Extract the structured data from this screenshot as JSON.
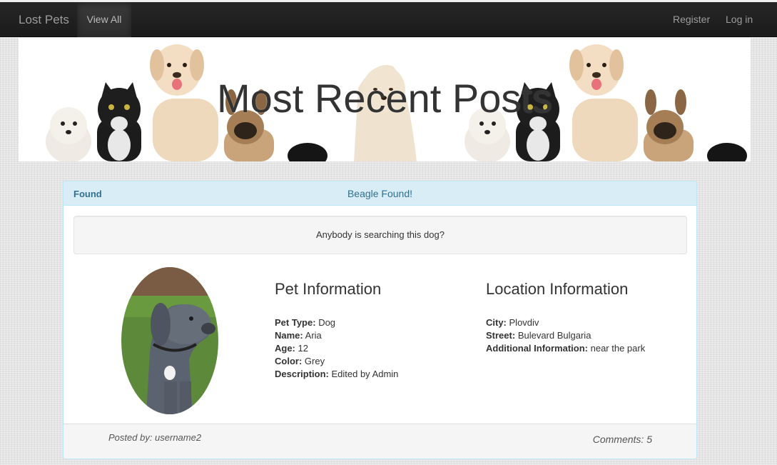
{
  "navbar": {
    "brand": "Lost Pets",
    "view_all": "View All",
    "register": "Register",
    "login": "Log in"
  },
  "banner": {
    "title": "Most Recent Posts"
  },
  "post": {
    "status": "Found",
    "title": "Beagle Found!",
    "description": "Anybody is searching this dog?",
    "pet_info": {
      "heading": "Pet Information",
      "rows": [
        {
          "label": "Pet Type:",
          "value": "Dog"
        },
        {
          "label": "Name:",
          "value": "Aria"
        },
        {
          "label": "Age:",
          "value": "12"
        },
        {
          "label": "Color:",
          "value": "Grey"
        },
        {
          "label": "Description:",
          "value": "Edited by Admin"
        }
      ]
    },
    "location_info": {
      "heading": "Location Information",
      "rows": [
        {
          "label": "City:",
          "value": "Plovdiv"
        },
        {
          "label": "Street:",
          "value": "Bulevard Bulgaria"
        },
        {
          "label": "Additional Information:",
          "value": "near the park"
        }
      ]
    },
    "posted_by": "Posted by:  username2",
    "comments": "Comments: 5"
  },
  "colors": {
    "navbar_bg": "#222222",
    "panel_heading_bg": "#d9edf7",
    "panel_heading_text": "#31708f"
  }
}
